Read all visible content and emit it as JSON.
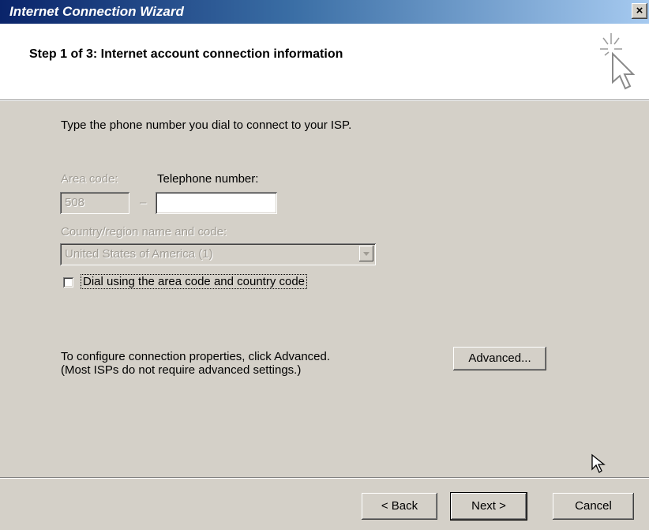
{
  "window": {
    "title": "Internet Connection Wizard",
    "close_label": "×"
  },
  "header": {
    "step_title": "Step 1 of 3: Internet account connection information",
    "icon": "wizard-sparkle-cursor-icon"
  },
  "main": {
    "instruction": "Type the phone number you dial to connect to your ISP.",
    "area_code_label": "Area code:",
    "area_code_value": "508",
    "dash": "–",
    "telephone_label": "Telephone number:",
    "telephone_value": "",
    "country_label": "Country/region name and code:",
    "country_value": "United States of America (1)",
    "dial_checkbox_label": "Dial using the area code and country code",
    "dial_checkbox_checked": false,
    "advanced_text_line1": "To configure connection properties, click Advanced.",
    "advanced_text_line2": "(Most ISPs do not require advanced settings.)",
    "advanced_button": "Advanced..."
  },
  "footer": {
    "back_button": "< Back",
    "next_button": "Next >",
    "cancel_button": "Cancel"
  }
}
